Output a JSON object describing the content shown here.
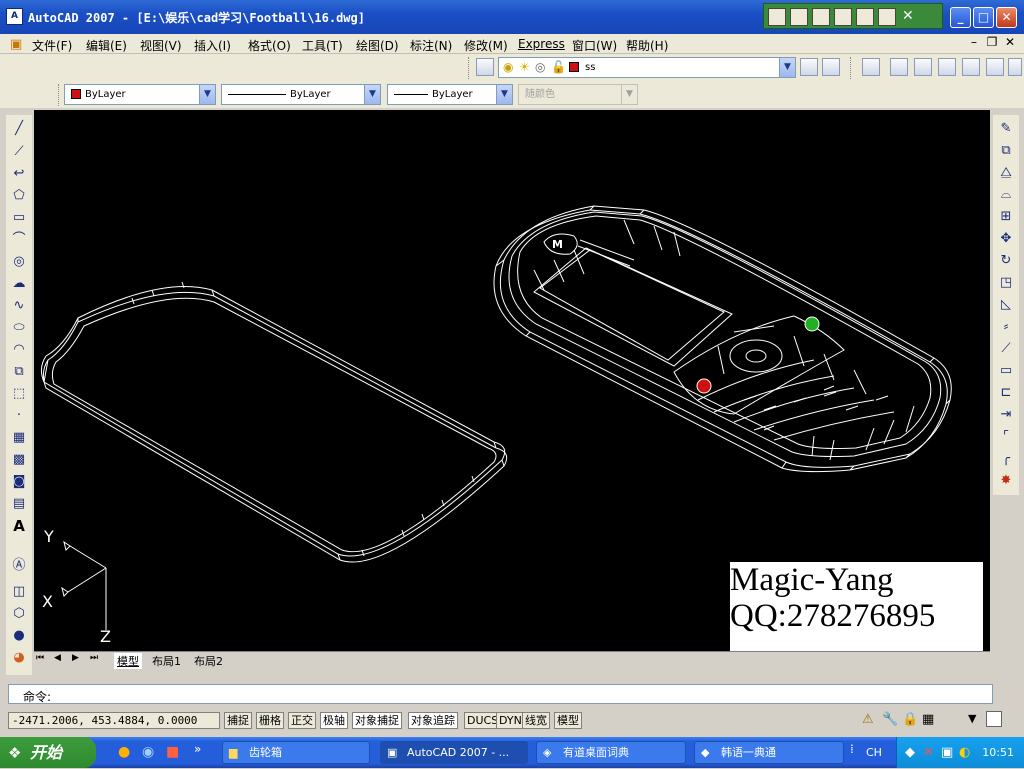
{
  "window": {
    "title": "AutoCAD 2007 - [E:\\娱乐\\cad学习\\Football\\16.dwg]",
    "app_icon": "A"
  },
  "menu": [
    "文件(F)",
    "编辑(E)",
    "视图(V)",
    "插入(I)",
    "格式(O)",
    "工具(T)",
    "绘图(D)",
    "标注(N)",
    "修改(M)",
    "Express",
    "窗口(W)",
    "帮助(H)"
  ],
  "layers": {
    "current_layer": "ss",
    "color": "ByLayer",
    "linetype": "ByLayer",
    "lineweight": "ByLayer",
    "plotstyle": "随颜色"
  },
  "tabs": [
    "模型",
    "布局1",
    "布局2"
  ],
  "command": {
    "prompt": "命令:"
  },
  "status": {
    "coords": "-2471.2006, 453.4884, 0.0000",
    "buttons": [
      "捕捉",
      "栅格",
      "正交",
      "极轴",
      "对象捕捉",
      "对象追踪",
      "DUCS",
      "DYN",
      "线宽",
      "模型"
    ]
  },
  "ucs": {
    "x": "X",
    "y": "Y",
    "z": "Z"
  },
  "watermark": {
    "line1": "Magic-Yang",
    "line2": "QQ:278276895"
  },
  "taskbar": {
    "start": "开始",
    "tasks": [
      "齿轮箱",
      "AutoCAD 2007 - ...",
      "有道桌面词典",
      "韩语一典通"
    ],
    "lang": "CH",
    "clock": "10:51"
  },
  "colors": {
    "title": "#1746b8",
    "canvas": "#000000",
    "layer_swatch": "#d01010",
    "taskbar": "#245edb",
    "start": "#2f8a2f"
  }
}
